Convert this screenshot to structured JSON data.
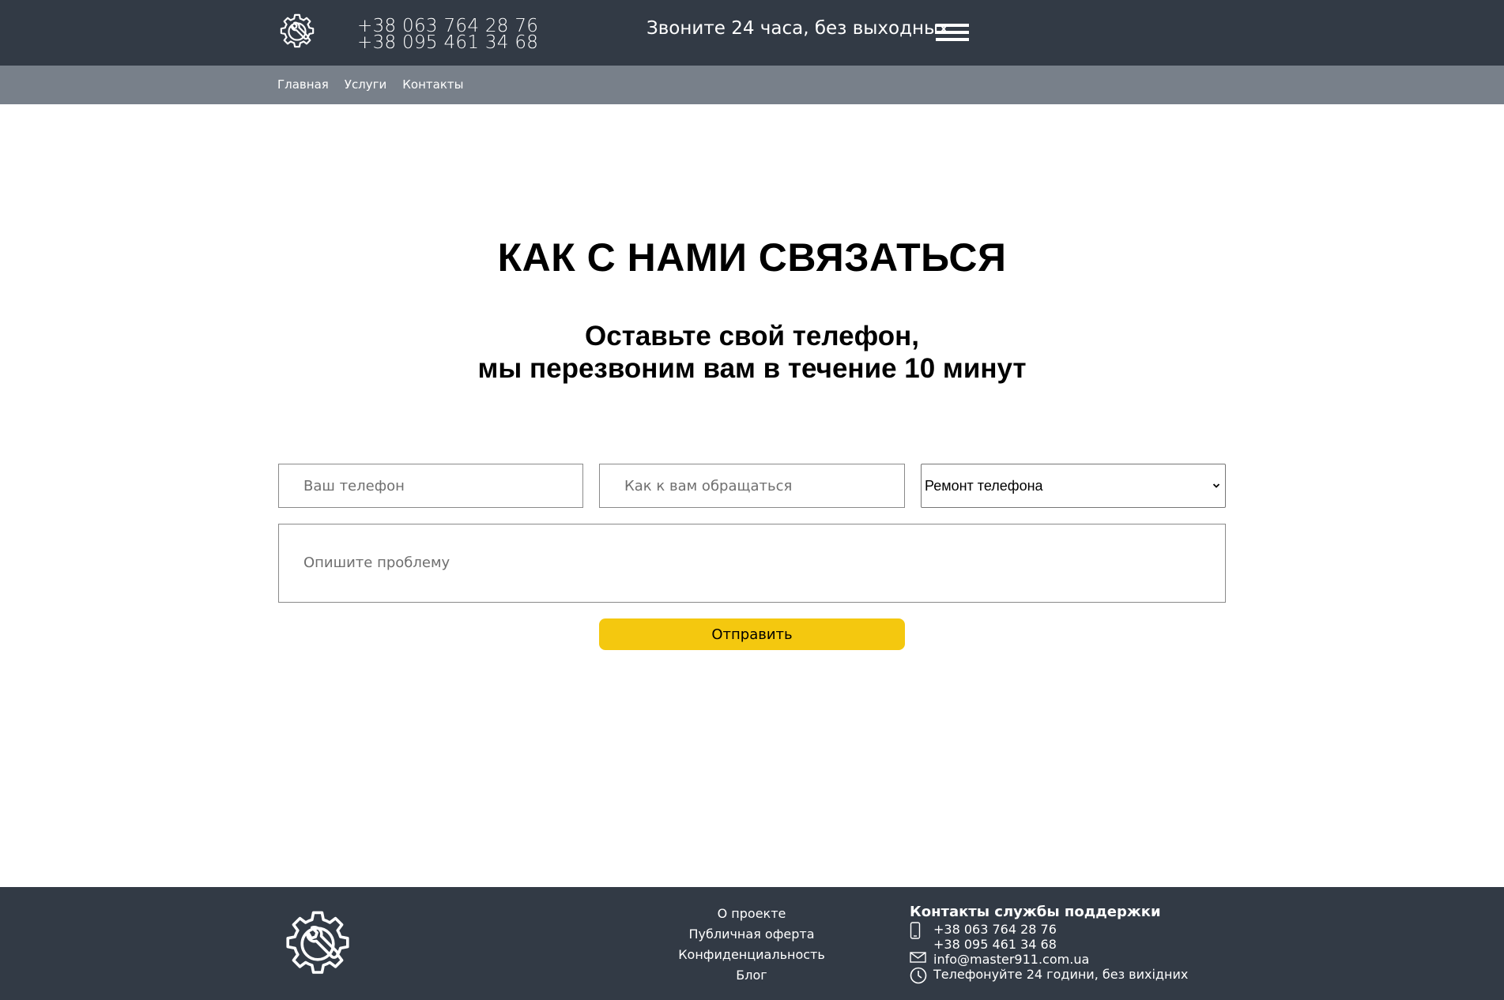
{
  "header": {
    "phones": [
      "+38 063 764 28 76",
      "+38 095 461 34 68"
    ],
    "hours": "Звоните 24 часа, без выходных"
  },
  "nav": {
    "items": [
      "Главная",
      "Услуги",
      "Контакты"
    ]
  },
  "main": {
    "title": "КАК С НАМИ СВЯЗАТЬСЯ",
    "subtitle_line1": "Оставьте свой телефон,",
    "subtitle_line2": "мы перезвоним вам в течение 10 минут",
    "form": {
      "phone_placeholder": "Ваш телефон",
      "name_placeholder": "Как к вам обращаться",
      "service_selected": "Ремонт телефона",
      "problem_placeholder": "Опишите проблему",
      "submit_label": "Отправить"
    }
  },
  "footer": {
    "links": [
      "О проекте",
      "Публичная оферта",
      "Конфиденциальность",
      "Блог"
    ],
    "support": {
      "title": "Контакты службы поддержки",
      "phones": [
        "+38 063 764 28 76",
        "+38 095 461 34 68"
      ],
      "email": "info@master911.com.ua",
      "hours": "Телефонуйте 24 години, без вихідних"
    }
  },
  "icons": {
    "logo": "gear-wrench-icon",
    "menu": "hamburger-icon",
    "phone": "mobile-phone-icon",
    "email": "envelope-icon",
    "hours": "clock-icon",
    "dropdown": "chevron-down-icon"
  },
  "colors": {
    "header_bg": "#323a45",
    "nav_bg": "#78808a",
    "accent": "#f4c80f",
    "footer_bg": "#323a45"
  }
}
